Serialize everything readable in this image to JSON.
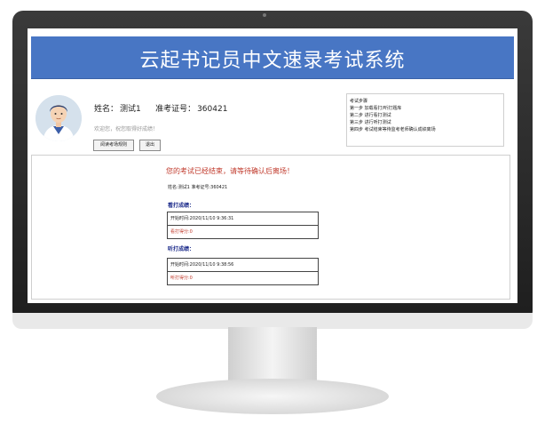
{
  "app": {
    "title": "云起书记员中文速录考试系统"
  },
  "user": {
    "name_label": "姓名：",
    "name_value": "测试1",
    "id_label": "准考证号：",
    "id_value": "360421",
    "welcome": "欢迎您，祝您取得好成绩！",
    "avatar": "student-avatar"
  },
  "buttons": {
    "read_rules": "阅读考场规则",
    "logout": "退出"
  },
  "steps": {
    "title": "考试步骤",
    "items": [
      "第一步 加载看打/听打题库",
      "第二步 进行看打测试",
      "第三步 进行听打测试",
      "第四步 考试结束等待监考老师确认成绩离场"
    ]
  },
  "result": {
    "notice": "您的考试已经结束，请等待确认后离场！",
    "info": "姓名:测试1  准考证号:360421",
    "kanda": {
      "heading": "看打成绩：",
      "start": "开始时间:2020/11/10 9:36:31",
      "score": "看打得分:0"
    },
    "tingda": {
      "heading": "听打成绩：",
      "start": "开始时间:2020/11/10 9:38:56",
      "score": "听打得分:0"
    }
  },
  "colors": {
    "banner": "#4876c4",
    "notice": "#c0392b",
    "heading": "#1b2a8a"
  }
}
